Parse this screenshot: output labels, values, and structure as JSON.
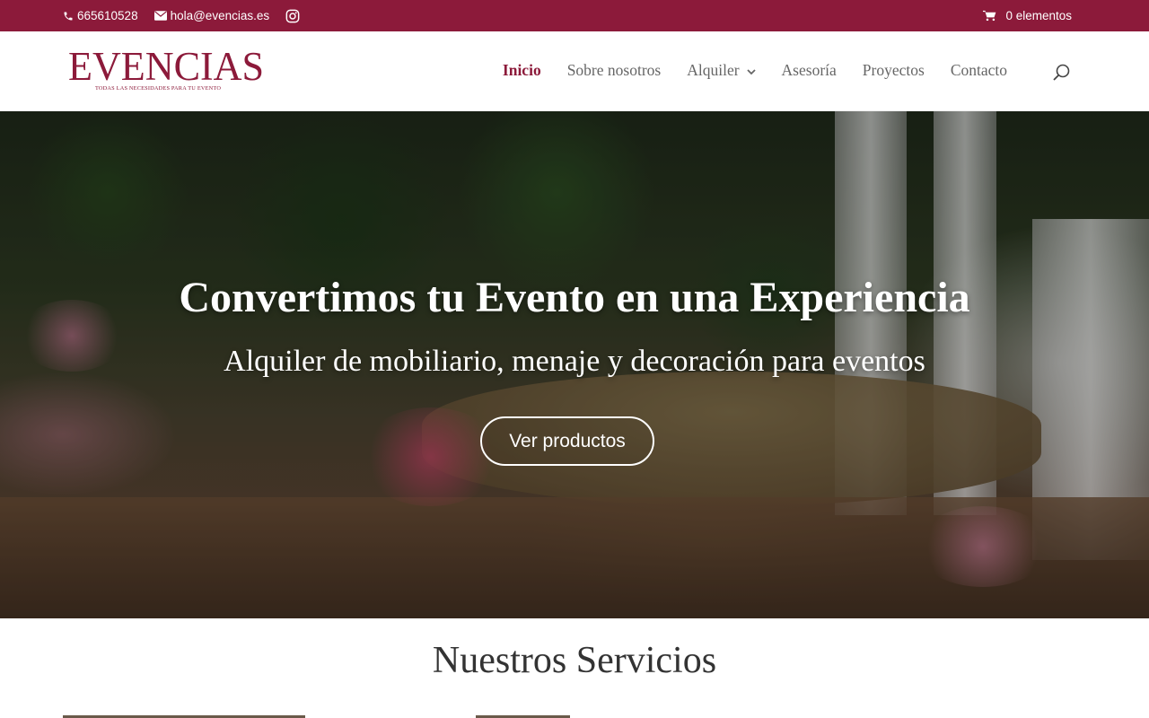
{
  "topbar": {
    "phone": "665610528",
    "email": "hola@evencias.es",
    "cart_label": "0 elementos",
    "icons": [
      "phone-icon",
      "mail-icon",
      "instagram-icon",
      "cart-icon"
    ]
  },
  "logo": {
    "text": "EVENCIAS",
    "tagline": "TODAS LAS NECESIDADES PARA TU EVENTO"
  },
  "nav": {
    "items": [
      {
        "label": "Inicio",
        "active": true
      },
      {
        "label": "Sobre nosotros",
        "active": false
      },
      {
        "label": "Alquiler",
        "active": false,
        "has_dropdown": true
      },
      {
        "label": "Asesoría",
        "active": false
      },
      {
        "label": "Proyectos",
        "active": false
      },
      {
        "label": "Contacto",
        "active": false
      }
    ]
  },
  "hero": {
    "title": "Convertimos tu Evento en una Experiencia",
    "subtitle": "Alquiler de mobiliario, menaje y decoración para eventos",
    "cta_label": "Ver productos"
  },
  "services": {
    "title": "Nuestros Servicios"
  },
  "colors": {
    "brand": "#8c1a3a",
    "nav_text": "#666666",
    "white": "#ffffff"
  }
}
